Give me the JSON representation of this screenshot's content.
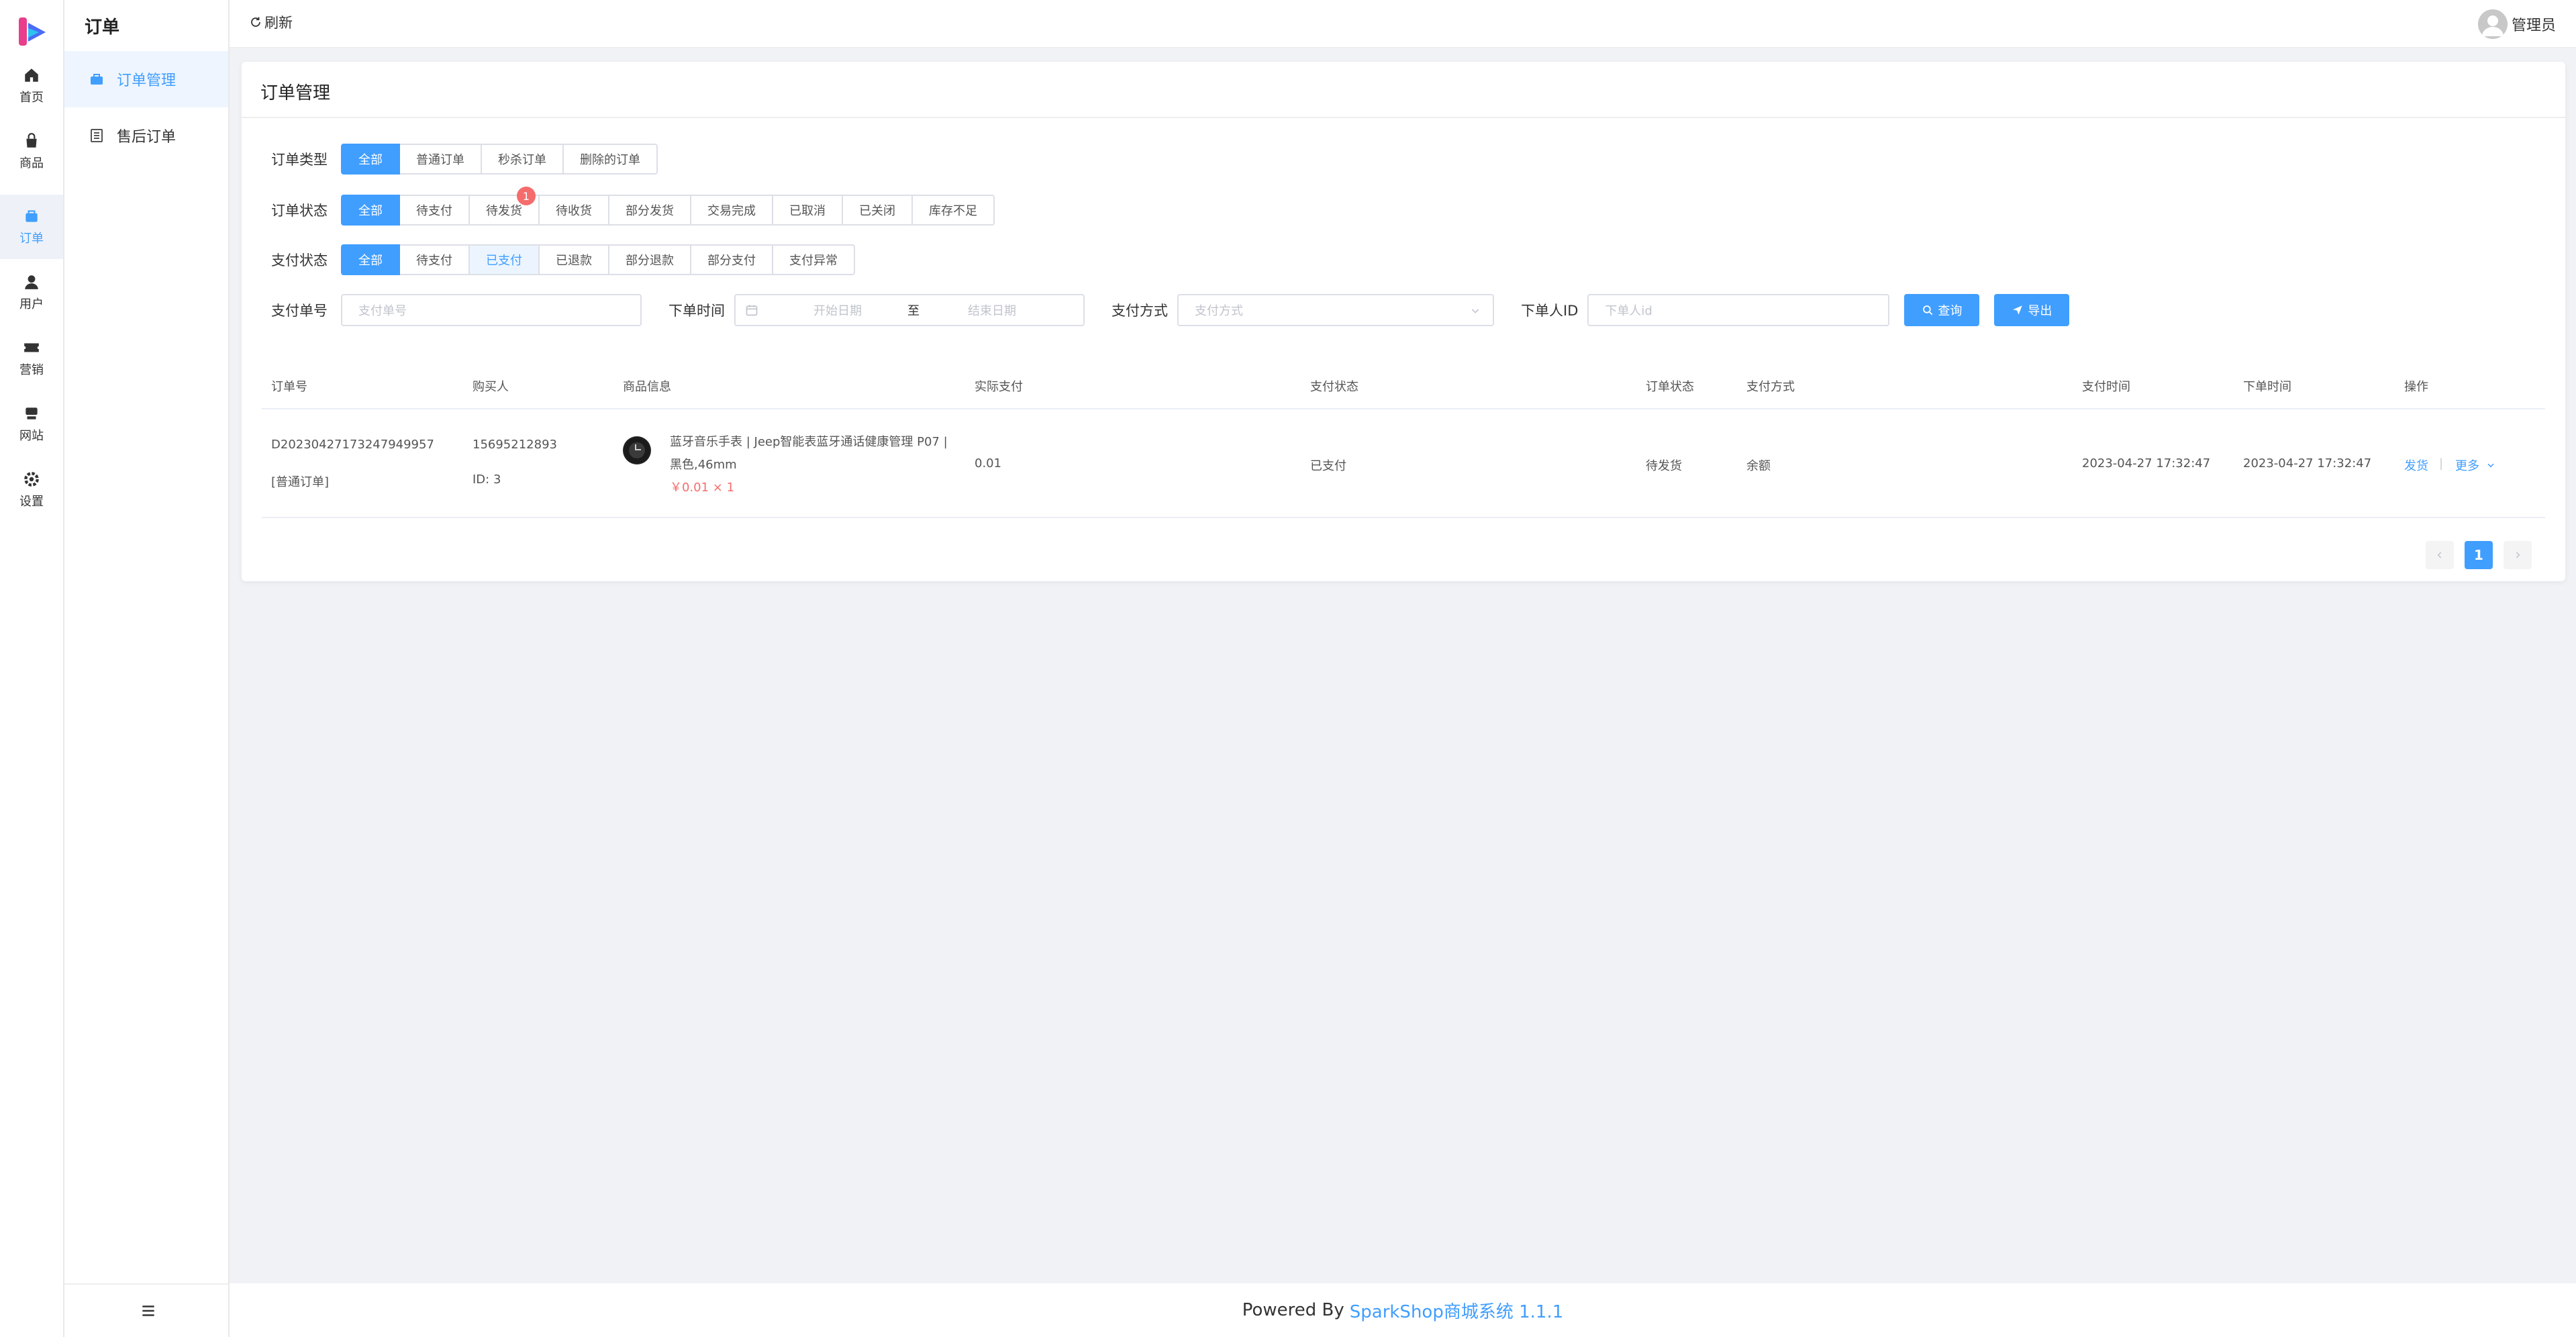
{
  "rail": {
    "items": [
      {
        "label": "首页",
        "icon": "home-icon"
      },
      {
        "label": "商品",
        "icon": "bag-icon"
      },
      {
        "label": "订单",
        "icon": "order-icon",
        "active": true
      },
      {
        "label": "用户",
        "icon": "user-icon"
      },
      {
        "label": "营销",
        "icon": "ticket-icon"
      },
      {
        "label": "网站",
        "icon": "store-icon"
      },
      {
        "label": "设置",
        "icon": "gear-icon"
      }
    ]
  },
  "submenu": {
    "title": "订单",
    "items": [
      {
        "label": "订单管理",
        "active": true
      },
      {
        "label": "售后订单"
      }
    ]
  },
  "topbar": {
    "refresh": "刷新",
    "user": "管理员"
  },
  "card": {
    "title": "订单管理",
    "order_type": {
      "label": "订单类型",
      "options": [
        "全部",
        "普通订单",
        "秒杀订单",
        "删除的订单"
      ]
    },
    "order_status": {
      "label": "订单状态",
      "options": [
        "全部",
        "待支付",
        "待发货",
        "待收货",
        "部分发货",
        "交易完成",
        "已取消",
        "已关闭",
        "库存不足"
      ],
      "badge": "1"
    },
    "pay_status": {
      "label": "支付状态",
      "options": [
        "全部",
        "待支付",
        "已支付",
        "已退款",
        "部分退款",
        "部分支付",
        "支付异常"
      ]
    },
    "search": {
      "pay_no_label": "支付单号",
      "pay_no_placeholder": "支付单号",
      "time_label": "下单时间",
      "start_placeholder": "开始日期",
      "range_sep": "至",
      "end_placeholder": "结束日期",
      "pay_method_label": "支付方式",
      "pay_method_placeholder": "支付方式",
      "user_id_label": "下单人ID",
      "user_id_placeholder": "下单人id",
      "query_btn": "查询",
      "export_btn": "导出"
    },
    "table": {
      "headers": [
        "订单号",
        "购买人",
        "商品信息",
        "实际支付",
        "支付状态",
        "订单状态",
        "支付方式",
        "支付时间",
        "下单时间",
        "操作"
      ],
      "rows": [
        {
          "order_no": "D20230427173247949957",
          "order_type": "[普通订单]",
          "buyer_phone": "15695212893",
          "buyer_id": "ID: 3",
          "goods_line1": "蓝牙音乐手表 | Jeep智能表蓝牙通话健康管理 P07 |",
          "goods_line2": "黑色,46mm",
          "goods_price": "￥0.01 × 1",
          "paid": "0.01",
          "pay_status": "已支付",
          "order_status": "待发货",
          "pay_method": "余额",
          "pay_time": "2023-04-27 17:32:47",
          "order_time": "2023-04-27 17:32:47",
          "action_ship": "发货",
          "action_sep": "|",
          "action_more": "更多"
        }
      ]
    },
    "pagination": {
      "current": "1"
    }
  },
  "footer": {
    "prefix": "Powered By",
    "brand": "SparkShop商城系统 1.1.1"
  },
  "colors": {
    "primary": "#409eff",
    "danger": "#f56c6c",
    "bg": "#f0f2f5"
  }
}
